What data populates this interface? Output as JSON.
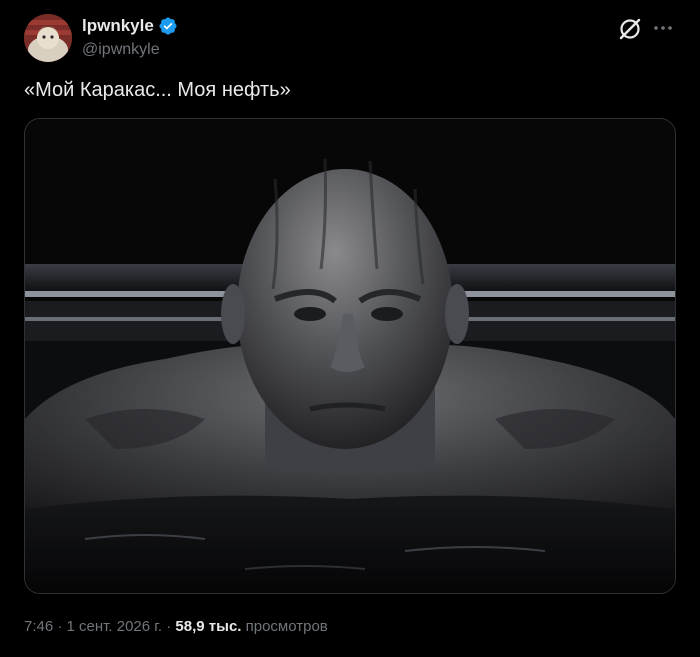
{
  "author": {
    "display_name": "lpwnkyle",
    "handle": "@ipwnkyle",
    "verified": true,
    "avatar_icon": "avatar-image"
  },
  "actions": {
    "grok_icon": "grok-icon",
    "more_icon": "more-icon"
  },
  "tweet": {
    "text": "«Мой Каракас... Моя нефть»"
  },
  "media": {
    "type": "image",
    "icon": "oil-figure-image"
  },
  "meta": {
    "time": "7:46",
    "date": "1 сент. 2026 г.",
    "separator": "·",
    "views_count": "58,9 тыс.",
    "views_label": "просмотров"
  },
  "colors": {
    "background": "#000000",
    "text_primary": "#e7e9ea",
    "text_secondary": "#71767b",
    "verified_blue": "#1d9bf0",
    "border": "#2f3336"
  }
}
